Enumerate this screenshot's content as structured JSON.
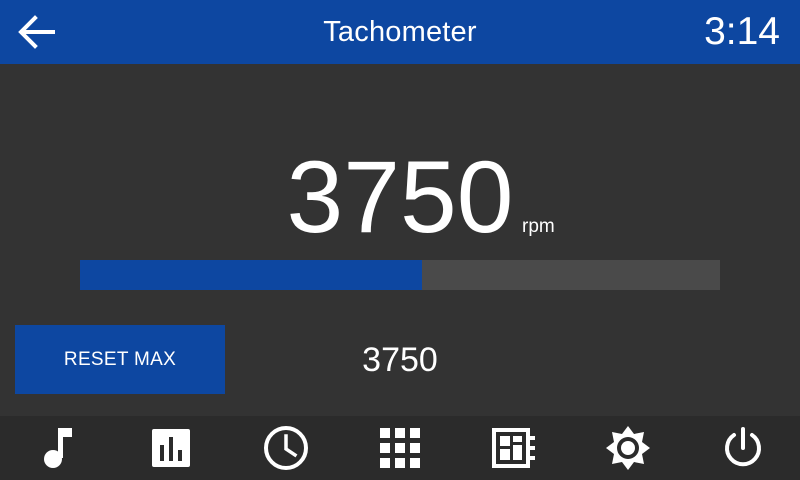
{
  "header": {
    "title": "Tachometer",
    "clock": "3:14",
    "back_icon": "arrow-left-icon"
  },
  "gauge": {
    "value": "3750",
    "unit": "rpm",
    "progress_fraction": 0.535
  },
  "controls": {
    "reset_label": "RESET MAX",
    "max_value": "3750"
  },
  "nav": {
    "items": [
      {
        "icon": "music-note-icon"
      },
      {
        "icon": "bar-chart-icon"
      },
      {
        "icon": "clock-icon"
      },
      {
        "icon": "apps-grid-icon"
      },
      {
        "icon": "dashboard-icon"
      },
      {
        "icon": "brightness-icon"
      },
      {
        "icon": "power-icon"
      }
    ]
  },
  "colors": {
    "accent": "#0d47a1",
    "background": "#333333",
    "nav_background": "#2b2b2b",
    "track": "#4a4a4a",
    "text": "#ffffff"
  }
}
